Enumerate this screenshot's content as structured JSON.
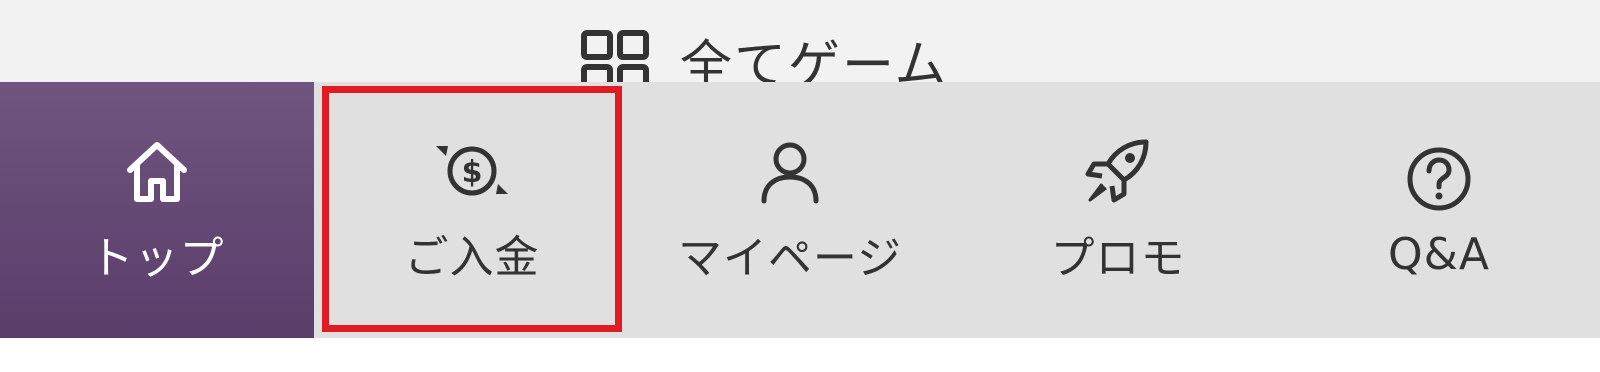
{
  "header": {
    "title": "全てゲーム",
    "icon": "grid-icon"
  },
  "nav": {
    "items": [
      {
        "label": "トップ",
        "icon": "home-icon",
        "active": true
      },
      {
        "label": "ご入金",
        "icon": "dollar-exchange-icon",
        "highlighted": true
      },
      {
        "label": "マイページ",
        "icon": "user-icon"
      },
      {
        "label": "プロモ",
        "icon": "rocket-icon"
      },
      {
        "label": "Q&A",
        "icon": "question-icon"
      }
    ]
  },
  "colors": {
    "active_bg": "#5b3d6a",
    "bar_bg": "#e0e0e0",
    "highlight_border": "#e01b22",
    "text": "#333333"
  }
}
